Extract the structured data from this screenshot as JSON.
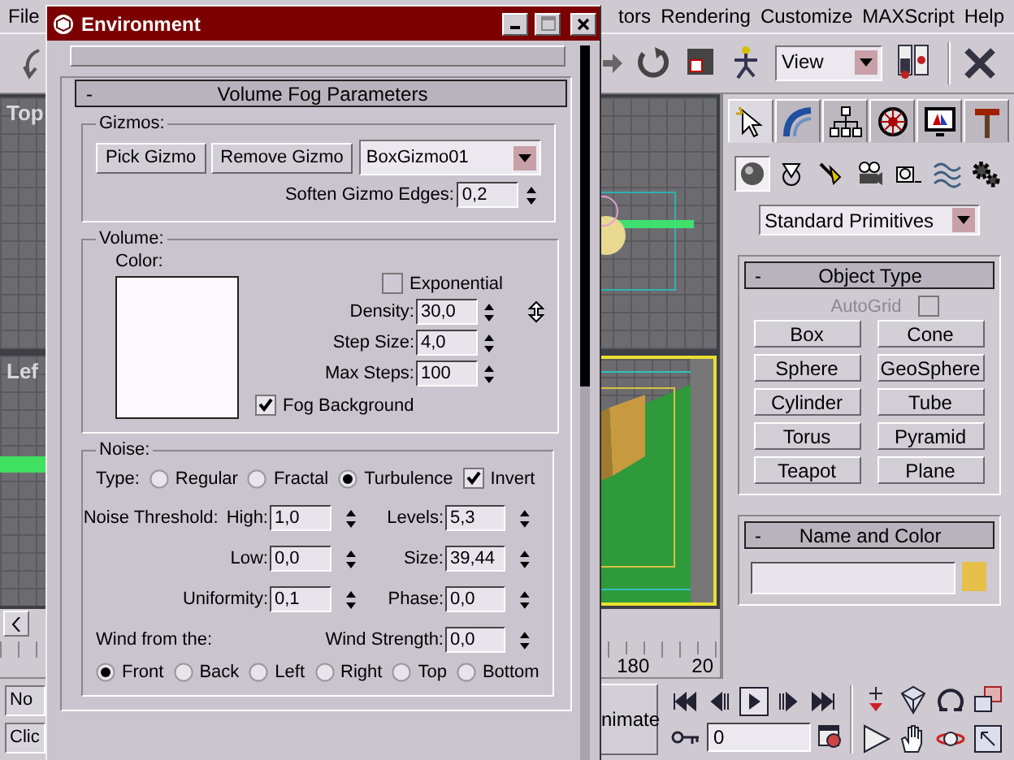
{
  "menu": [
    {
      "label": "File"
    },
    {
      "label": "tors"
    },
    {
      "label": "Rendering"
    },
    {
      "label": "Customize"
    },
    {
      "label": "MAXScript"
    },
    {
      "label": "Help"
    }
  ],
  "toolbar": {
    "view_dropdown": "View"
  },
  "viewports": [
    {
      "label": "Top"
    },
    {
      "label": "Lef"
    }
  ],
  "command_panel": {
    "tabs": [
      {
        "kind": "create",
        "selected": true
      },
      {
        "kind": "modify",
        "selected": false
      },
      {
        "kind": "hierarchy",
        "selected": false
      },
      {
        "kind": "motion",
        "selected": false
      },
      {
        "kind": "display",
        "selected": false
      },
      {
        "kind": "utilities",
        "selected": false
      }
    ],
    "categories": [
      {
        "kind": "geometry",
        "selected": true
      },
      {
        "kind": "shapes",
        "selected": false
      },
      {
        "kind": "lights",
        "selected": false
      },
      {
        "kind": "cameras",
        "selected": false
      },
      {
        "kind": "helpers",
        "selected": false
      },
      {
        "kind": "spacewarps",
        "selected": false
      },
      {
        "kind": "systems",
        "selected": false
      }
    ],
    "dropdown": "Standard Primitives",
    "object_type": {
      "toggle": "-",
      "title": "Object Type",
      "autogrid": {
        "label": "AutoGrid",
        "checked": false,
        "disabled": true
      },
      "buttons": [
        "Box",
        "Cone",
        "Sphere",
        "GeoSphere",
        "Cylinder",
        "Tube",
        "Torus",
        "Pyramid",
        "Teapot",
        "Plane"
      ]
    },
    "name_and_color": {
      "toggle": "-",
      "title": "Name and Color"
    }
  },
  "timeline": {
    "labels": [
      "180",
      "20"
    ]
  },
  "status": [
    "No",
    "Clic"
  ],
  "animate_button": "nimate",
  "time_field": "0",
  "dialog": {
    "title": "Environment",
    "rollout_toggle": "-",
    "rollout": "Volume Fog Parameters",
    "gizmos": {
      "label": "Gizmos:",
      "pick": "Pick Gizmo",
      "remove": "Remove Gizmo",
      "gizmo": "BoxGizmo01",
      "soften": {
        "label": "Soften Gizmo Edges:",
        "value": "0,2"
      }
    },
    "volume": {
      "label": "Volume:",
      "color_label": "Color:",
      "exponential": {
        "label": "Exponential",
        "checked": false
      },
      "fields": [
        {
          "label": "Density:",
          "value": "30,0"
        },
        {
          "label": "Step Size:",
          "value": "4,0"
        },
        {
          "label": "Max Steps:",
          "value": "100"
        }
      ],
      "fog_background": {
        "label": "Fog Background",
        "checked": true
      }
    },
    "noise": {
      "label": "Noise:",
      "type_label": "Type:",
      "types": [
        {
          "label": "Regular",
          "selected": false
        },
        {
          "label": "Fractal",
          "selected": false
        },
        {
          "label": "Turbulence",
          "selected": true
        }
      ],
      "invert": {
        "label": "Invert",
        "checked": true
      },
      "threshold_label": "Noise Threshold:",
      "fields": [
        {
          "label": "High:",
          "value": "1,0"
        },
        {
          "label": "Levels:",
          "value": "5,3"
        },
        {
          "label": "Low:",
          "value": "0,0"
        },
        {
          "label": "Size:",
          "value": "39,44"
        },
        {
          "label": "Uniformity:",
          "value": "0,1"
        },
        {
          "label": "Phase:",
          "value": "0,0"
        }
      ],
      "wind_label": "Wind from the:",
      "wind_strength": {
        "label": "Wind Strength:",
        "value": "0,0"
      },
      "wind_dirs": [
        {
          "label": "Front",
          "selected": true
        },
        {
          "label": "Back",
          "selected": false
        },
        {
          "label": "Left",
          "selected": false
        },
        {
          "label": "Right",
          "selected": false
        },
        {
          "label": "Top",
          "selected": false
        },
        {
          "label": "Bottom",
          "selected": false
        }
      ]
    }
  }
}
